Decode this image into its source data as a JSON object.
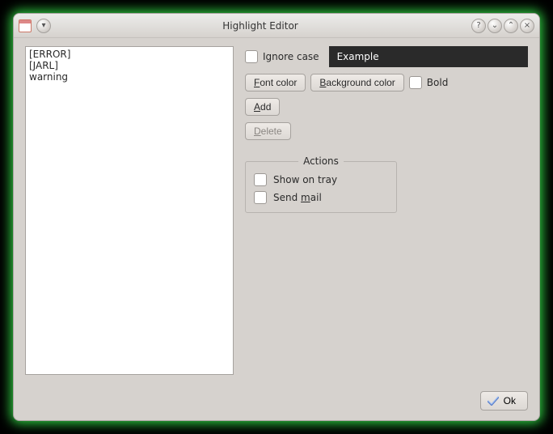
{
  "title": "Highlight Editor",
  "list": {
    "items": [
      "[ERROR]",
      "[JARL]",
      "warning"
    ]
  },
  "options": {
    "ignore_case_label": "Ignore case",
    "example_label": "Example",
    "font_color_btn": "Font color",
    "background_color_btn": "Background color",
    "bold_label": "Bold",
    "add_btn": "Add",
    "delete_btn": "Delete"
  },
  "actions": {
    "group_title": "Actions",
    "show_on_tray_label": "Show on tray",
    "send_mail_label": "Send mail"
  },
  "footer": {
    "ok_label": "Ok"
  },
  "titlebar": {
    "help": "?",
    "min": "⌄",
    "max": "⌃",
    "close": "×",
    "menu": "▾"
  }
}
